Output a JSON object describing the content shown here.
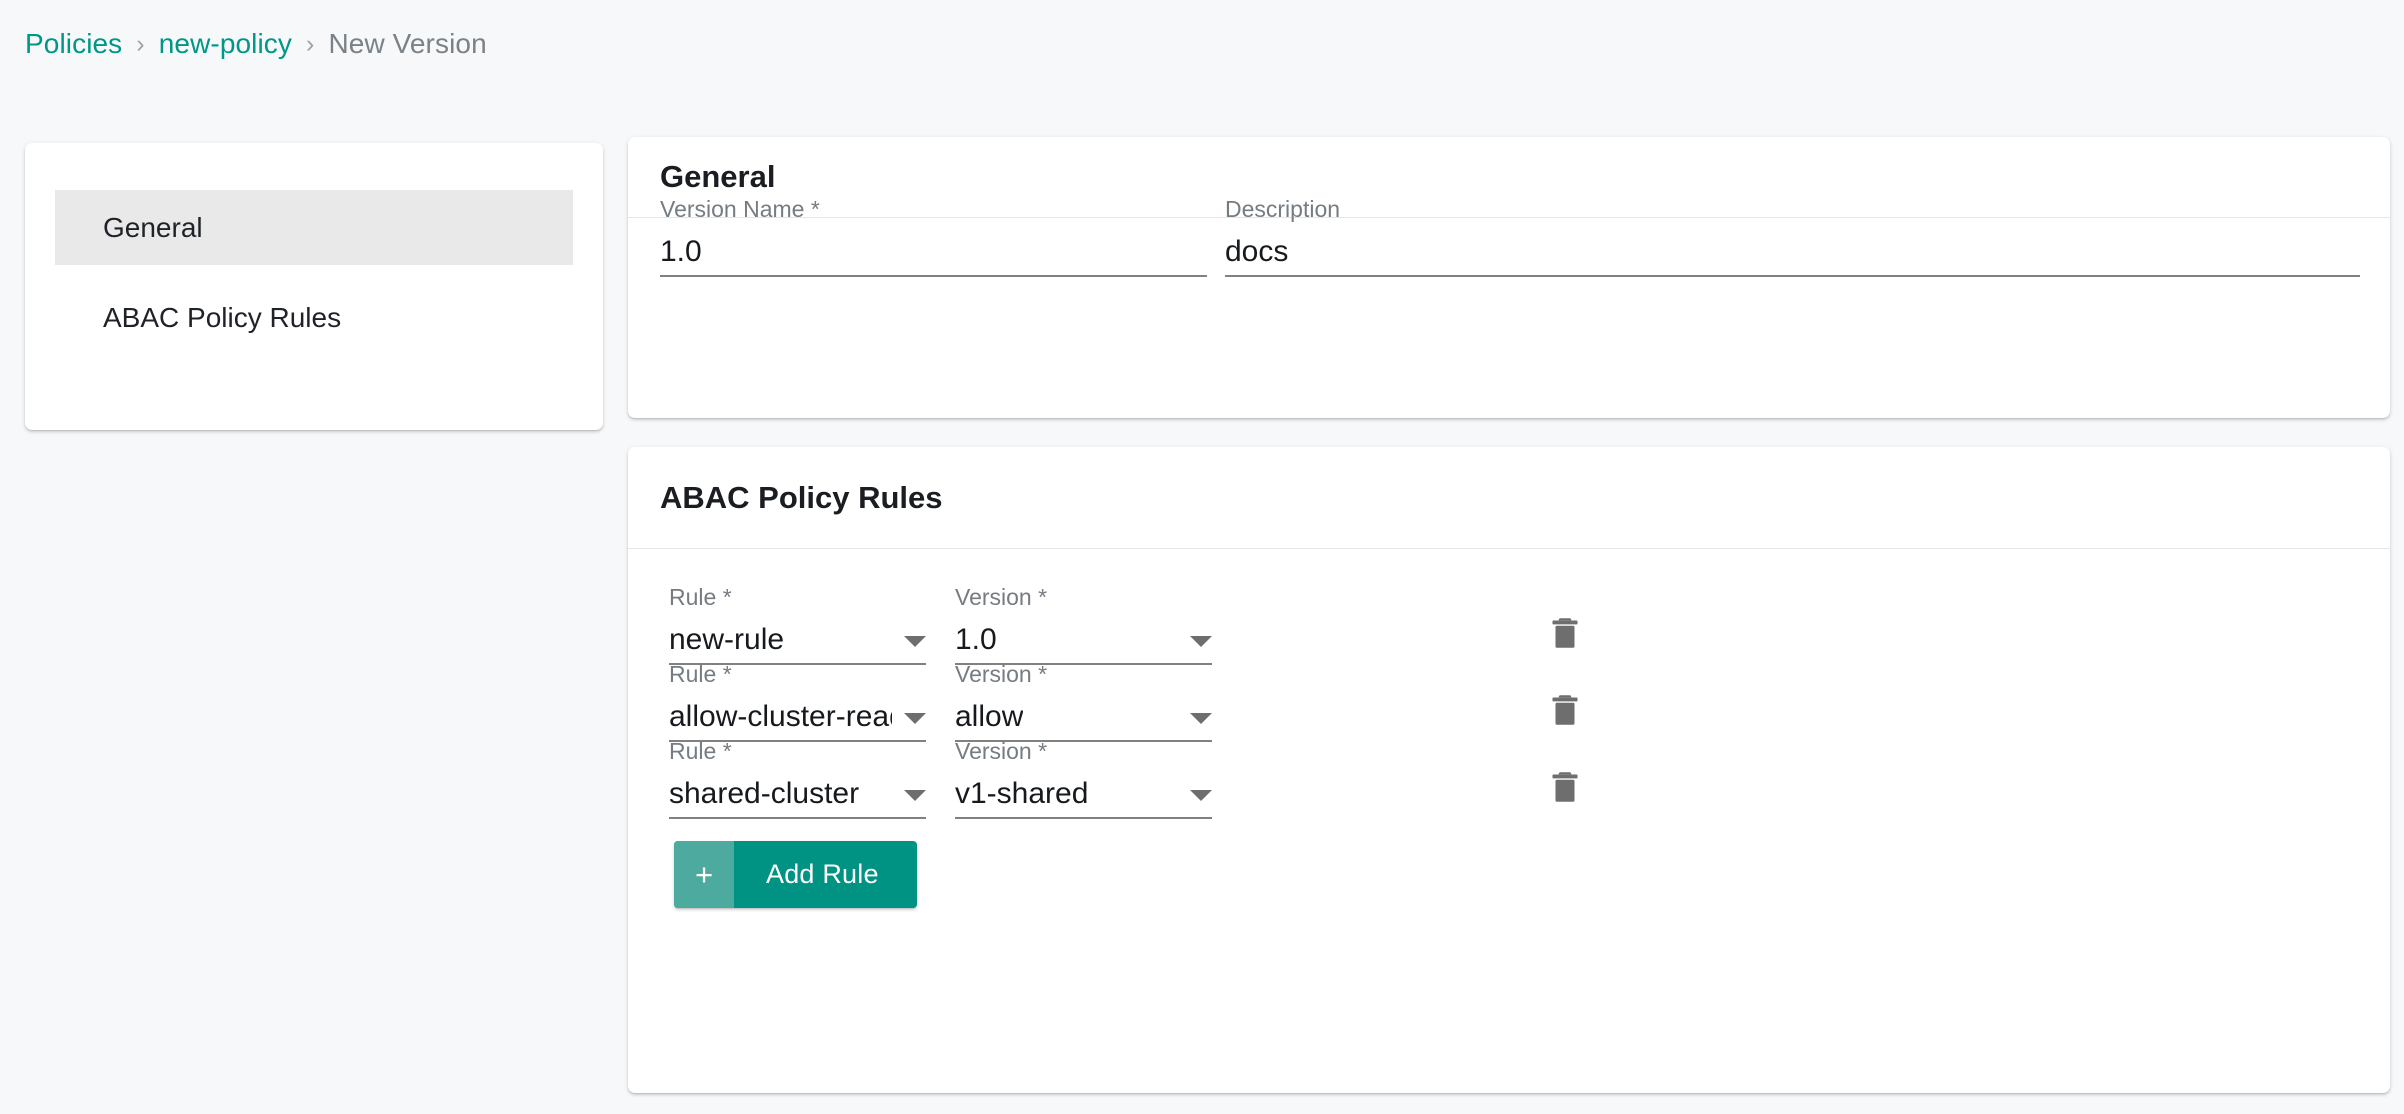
{
  "breadcrumb": {
    "items": [
      {
        "label": "Policies",
        "type": "link"
      },
      {
        "label": "new-policy",
        "type": "link"
      },
      {
        "label": "New Version",
        "type": "current"
      }
    ],
    "separator": "›"
  },
  "sidebar": {
    "items": [
      {
        "label": "General",
        "selected": true
      },
      {
        "label": "ABAC Policy Rules",
        "selected": false
      }
    ]
  },
  "general_card": {
    "title": "General",
    "fields": {
      "version_name": {
        "label": "Version Name *",
        "value": "1.0",
        "placeholder": ""
      },
      "description": {
        "label": "Description",
        "value": "docs",
        "placeholder": ""
      }
    }
  },
  "abac_card": {
    "title": "ABAC Policy Rules",
    "labels": {
      "rule": "Rule *",
      "version": "Version *"
    },
    "rules": [
      {
        "rule": "new-rule",
        "version": "1.0"
      },
      {
        "rule": "allow-cluster-read",
        "version": "allow"
      },
      {
        "rule": "shared-cluster",
        "version": "v1-shared"
      }
    ],
    "delete_icon": "trash-icon",
    "add_button": {
      "label": "Add Rule",
      "icon": "plus-icon",
      "icon_glyph": "+"
    }
  },
  "colors": {
    "brand_teal": "#009688",
    "button_teal": "#009384",
    "button_teal_light": "#4daa9e",
    "page_background": "#f6f8fa",
    "card_background": "#ffffff",
    "selected_nav_background": "#e9e9e9",
    "label_grey": "#757c82",
    "icon_grey": "#6e6e6e"
  }
}
